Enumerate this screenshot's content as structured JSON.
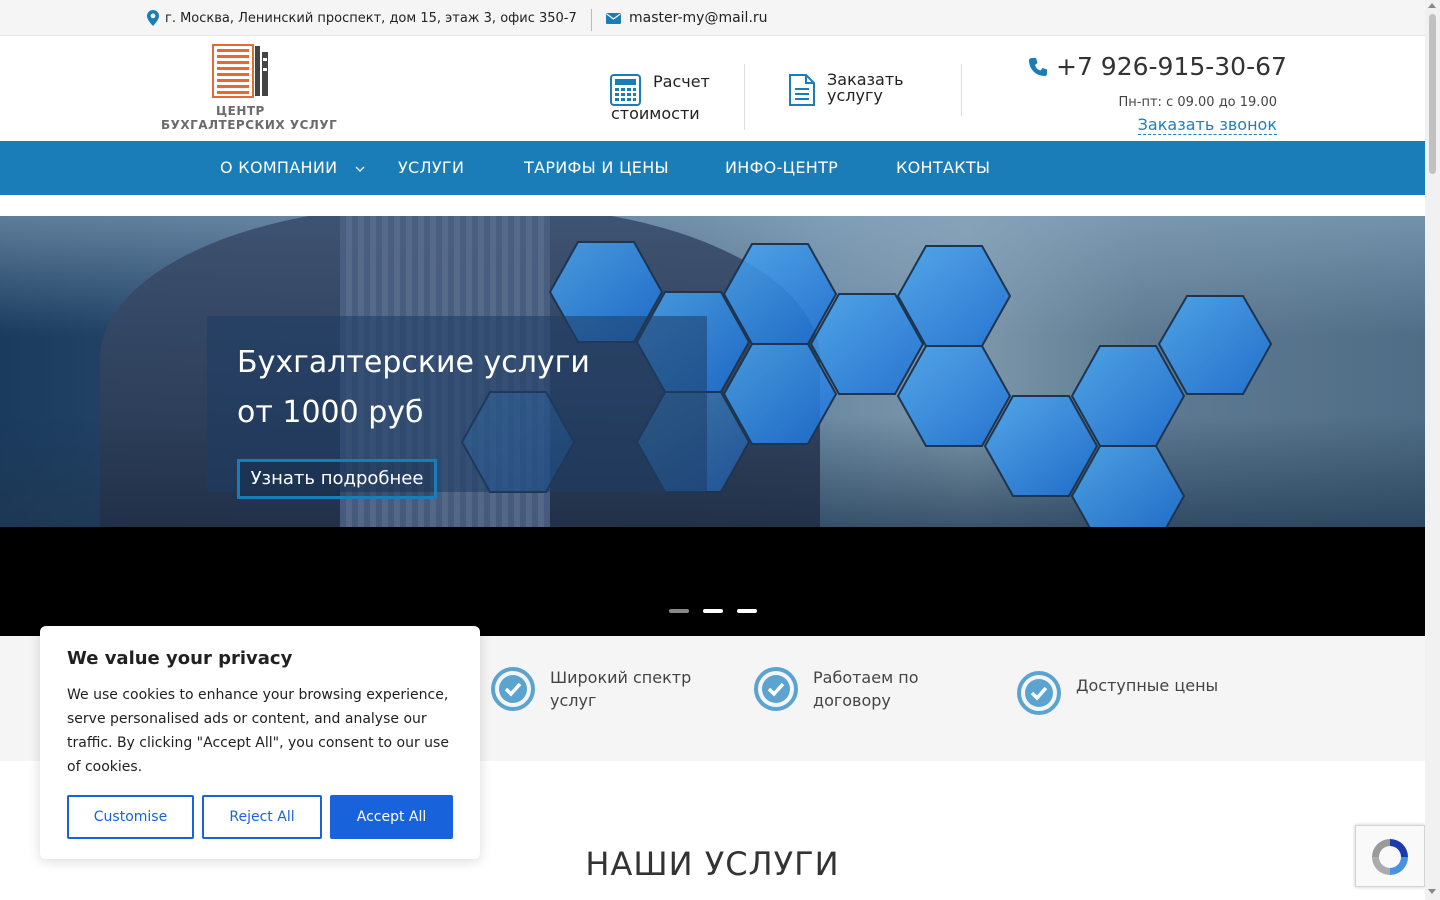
{
  "topbar": {
    "address": "г. Москва, Ленинский проспект, дом 15, этаж 3, офис 350-7",
    "email": "master-my@mail.ru"
  },
  "header": {
    "logo_line1": "ЦЕНТР",
    "logo_line2": "БУХГАЛТЕРСКИХ  УСЛУГ",
    "calc_line1": "Расчет",
    "calc_line2": "стоимости",
    "order_label": "Заказать услугу",
    "phone": "+7 926-915-30-67",
    "hours": "Пн-пт: с 09.00 до 19.00",
    "callback": "Заказать звонок"
  },
  "nav": {
    "items": [
      {
        "label": "О КОМПАНИИ"
      },
      {
        "label": "УСЛУГИ"
      },
      {
        "label": "ТАРИФЫ И ЦЕНЫ"
      },
      {
        "label": "ИНФО-ЦЕНТР"
      },
      {
        "label": "КОНТАКТЫ"
      }
    ]
  },
  "hero": {
    "title_line1": "Бухгалтерские услуги",
    "title_line2": "от 1000 руб",
    "button": "Узнать подробнее",
    "slides_total": 3,
    "active_slide": 1
  },
  "features": [
    {
      "text": "Широкий спектр услуг"
    },
    {
      "text": "Работаем по договору"
    },
    {
      "text": "Доступные цены"
    }
  ],
  "section": {
    "title": "НАШИ УСЛУГИ"
  },
  "cookie": {
    "title": "We value your privacy",
    "body": "We use cookies to enhance your browsing experience, serve personalised ads or content, and analyse our traffic. By clicking \"Accept All\", you consent to our use of cookies.",
    "customise": "Customise",
    "reject": "Reject All",
    "accept": "Accept All"
  },
  "colors": {
    "brand_blue": "#1a7db7",
    "cookie_blue": "#1863dc",
    "logo_orange": "#e8692e",
    "check_blue": "#5ba4cf"
  },
  "icons": {
    "location": "map-pin-icon",
    "mail": "envelope-icon",
    "calculator": "calculator-icon",
    "document": "document-icon",
    "phone": "phone-icon",
    "check": "check-circle-icon",
    "recaptcha": "recaptcha-icon"
  }
}
